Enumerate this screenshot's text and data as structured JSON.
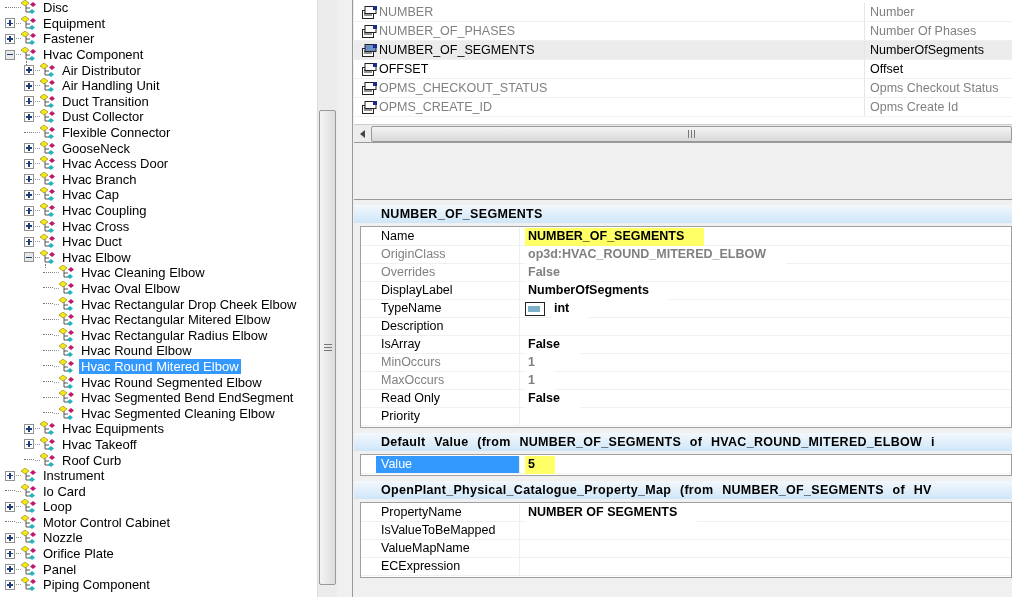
{
  "tree": [
    {
      "label": "Disc",
      "leaf": true,
      "selected": false
    },
    {
      "label": "Equipment",
      "expanded": false,
      "leaf": false,
      "selected": false
    },
    {
      "label": "Fastener",
      "expanded": false,
      "leaf": false,
      "selected": false
    },
    {
      "label": "Hvac Component",
      "expanded": true,
      "leaf": false,
      "selected": false,
      "children": [
        {
          "label": "Air Distributor",
          "expanded": false,
          "leaf": false,
          "selected": false
        },
        {
          "label": "Air Handling Unit",
          "expanded": false,
          "leaf": false,
          "selected": false
        },
        {
          "label": "Duct Transition",
          "expanded": false,
          "leaf": false,
          "selected": false
        },
        {
          "label": "Dust Collector",
          "expanded": false,
          "leaf": false,
          "selected": false
        },
        {
          "label": "Flexible Connector",
          "leaf": true,
          "selected": false
        },
        {
          "label": "GooseNeck",
          "expanded": false,
          "leaf": false,
          "selected": false
        },
        {
          "label": "Hvac Access Door",
          "expanded": false,
          "leaf": false,
          "selected": false
        },
        {
          "label": "Hvac Branch",
          "expanded": false,
          "leaf": false,
          "selected": false
        },
        {
          "label": "Hvac Cap",
          "expanded": false,
          "leaf": false,
          "selected": false
        },
        {
          "label": "Hvac Coupling",
          "expanded": false,
          "leaf": false,
          "selected": false
        },
        {
          "label": "Hvac Cross",
          "expanded": false,
          "leaf": false,
          "selected": false
        },
        {
          "label": "Hvac Duct",
          "expanded": false,
          "leaf": false,
          "selected": false
        },
        {
          "label": "Hvac Elbow",
          "expanded": true,
          "leaf": false,
          "selected": false,
          "children": [
            {
              "label": "Hvac Cleaning Elbow",
              "leaf": true,
              "selected": false
            },
            {
              "label": "Hvac Oval Elbow",
              "leaf": true,
              "selected": false
            },
            {
              "label": "Hvac Rectangular Drop Cheek Elbow",
              "leaf": true,
              "selected": false
            },
            {
              "label": "Hvac Rectangular Mitered Elbow",
              "leaf": true,
              "selected": false
            },
            {
              "label": "Hvac Rectangular Radius Elbow",
              "leaf": true,
              "selected": false
            },
            {
              "label": "Hvac Round Elbow",
              "leaf": true,
              "selected": false
            },
            {
              "label": "Hvac Round Mitered Elbow",
              "leaf": true,
              "selected": true
            },
            {
              "label": "Hvac Round Segmented Elbow",
              "leaf": true,
              "selected": false
            },
            {
              "label": "Hvac Segmented Bend EndSegment",
              "leaf": true,
              "selected": false
            },
            {
              "label": "Hvac Segmented Cleaning Elbow",
              "leaf": true,
              "selected": false
            }
          ]
        },
        {
          "label": "Hvac Equipments",
          "expanded": false,
          "leaf": false,
          "selected": false
        },
        {
          "label": "Hvac Takeoff",
          "expanded": false,
          "leaf": false,
          "selected": false
        },
        {
          "label": "Roof Curb",
          "leaf": true,
          "selected": false
        }
      ]
    },
    {
      "label": "Instrument",
      "expanded": false,
      "leaf": false,
      "selected": false
    },
    {
      "label": "Io Card",
      "leaf": true,
      "selected": false
    },
    {
      "label": "Loop",
      "expanded": false,
      "leaf": false,
      "selected": false
    },
    {
      "label": "Motor Control Cabinet",
      "leaf": true,
      "selected": false
    },
    {
      "label": "Nozzle",
      "expanded": false,
      "leaf": false,
      "selected": false
    },
    {
      "label": "Orifice Plate",
      "expanded": false,
      "leaf": false,
      "selected": false
    },
    {
      "label": "Panel",
      "expanded": false,
      "leaf": false,
      "selected": false
    },
    {
      "label": "Piping Component",
      "expanded": false,
      "leaf": false,
      "selected": false
    }
  ],
  "property_list": [
    {
      "name": "NUMBER",
      "label": "Number",
      "disabled": true,
      "selected": false
    },
    {
      "name": "NUMBER_OF_PHASES",
      "label": "Number Of Phases",
      "disabled": true,
      "selected": false
    },
    {
      "name": "NUMBER_OF_SEGMENTS",
      "label": "NumberOfSegments",
      "disabled": false,
      "selected": true
    },
    {
      "name": "OFFSET",
      "label": "Offset",
      "disabled": false,
      "selected": false
    },
    {
      "name": "OPMS_CHECKOUT_STATUS",
      "label": "Opms Checkout Status",
      "disabled": true,
      "selected": false
    },
    {
      "name": "OPMS_CREATE_ID",
      "label": "Opms Create Id",
      "disabled": true,
      "selected": false
    }
  ],
  "sections": [
    {
      "title": "NUMBER_OF_SEGMENTS",
      "rows": [
        {
          "label": "Name",
          "value": "NUMBER_OF_SEGMENTS",
          "disabled": false,
          "highlighted": true,
          "selected": false
        },
        {
          "label": "OriginClass",
          "value": "op3d:HVAC_ROUND_MITERED_ELBOW",
          "disabled": true,
          "highlighted": false,
          "selected": false
        },
        {
          "label": "Overrides",
          "value": "False",
          "disabled": true,
          "highlighted": false,
          "selected": false
        },
        {
          "label": "DisplayLabel",
          "value": "NumberOfSegments",
          "disabled": false,
          "highlighted": false,
          "selected": false
        },
        {
          "label": "TypeName",
          "value": "int",
          "kind": "type",
          "disabled": false,
          "highlighted": false,
          "selected": false
        },
        {
          "label": "Description",
          "disabled": false,
          "selected": false
        },
        {
          "label": "IsArray",
          "value": "False",
          "disabled": false,
          "highlighted": false,
          "selected": false
        },
        {
          "label": "MinOccurs",
          "value": "1",
          "disabled": true,
          "highlighted": false,
          "selected": false
        },
        {
          "label": "MaxOccurs",
          "value": "1",
          "disabled": true,
          "highlighted": false,
          "selected": false
        },
        {
          "label": "Read Only",
          "value": "False",
          "disabled": false,
          "highlighted": false,
          "selected": false
        },
        {
          "label": "Priority",
          "disabled": false,
          "selected": false
        }
      ]
    },
    {
      "title": "Default Value (from NUMBER_OF_SEGMENTS of HVAC_ROUND_MITERED_ELBOW i",
      "rows": [
        {
          "label": "Value",
          "value": "5",
          "disabled": false,
          "highlighted": true,
          "selected": true
        }
      ]
    },
    {
      "title": "OpenPlant_Physical_Catalogue_Property_Map (from NUMBER_OF_SEGMENTS of HV",
      "rows": [
        {
          "label": "PropertyName",
          "value": "NUMBER OF SEGMENTS",
          "disabled": false,
          "highlighted": false,
          "selected": false
        },
        {
          "label": "IsValueToBeMapped",
          "disabled": false,
          "selected": false
        },
        {
          "label": "ValueMapName",
          "disabled": false,
          "selected": false
        },
        {
          "label": "ECExpression",
          "disabled": false,
          "selected": false
        }
      ]
    }
  ]
}
